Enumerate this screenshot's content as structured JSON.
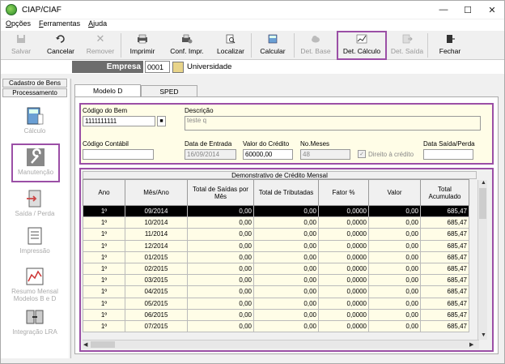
{
  "window": {
    "title": "CIAP/CIAF"
  },
  "menu": [
    "Opções",
    "Ferramentas",
    "Ajuda"
  ],
  "toolbar": [
    {
      "label": "Salvar",
      "icon": "save-icon",
      "disabled": true
    },
    {
      "label": "Cancelar",
      "icon": "undo-icon",
      "disabled": false
    },
    {
      "label": "Remover",
      "icon": "remove-icon",
      "disabled": true
    },
    {
      "label": "Imprimir",
      "icon": "printer-icon",
      "disabled": false
    },
    {
      "label": "Conf. Impr.",
      "icon": "print-settings-icon",
      "disabled": false
    },
    {
      "label": "Localizar",
      "icon": "find-icon",
      "disabled": false
    },
    {
      "label": "Calcular",
      "icon": "calculator-icon",
      "disabled": false
    },
    {
      "label": "Det. Base",
      "icon": "cloud-icon",
      "disabled": true
    },
    {
      "label": "Det. Cálculo",
      "icon": "chart-icon",
      "disabled": false
    },
    {
      "label": "Det. Saída",
      "icon": "exit-detail-icon",
      "disabled": true
    },
    {
      "label": "Fechar",
      "icon": "close-door-icon",
      "disabled": false
    }
  ],
  "empresa": {
    "label": "Empresa",
    "code": "0001",
    "name": "Universidade"
  },
  "sidebar": {
    "tabs": [
      "Cadastro de Bens",
      "Processamento"
    ],
    "items": [
      {
        "label": "Cálculo",
        "icon": "calculator-icon"
      },
      {
        "label": "Manutenção",
        "icon": "wrench-icon"
      },
      {
        "label": "Saída / Perda",
        "icon": "exit-icon"
      },
      {
        "label": "Impressão",
        "icon": "print-icon"
      },
      {
        "label": "Resumo Mensal Modelos B e D",
        "icon": "report-chart-icon"
      },
      {
        "label": "Integração LRA",
        "icon": "integration-icon"
      }
    ]
  },
  "tabs": [
    "Modelo D",
    "SPED"
  ],
  "form": {
    "codigo_bem_label": "Código do Bem",
    "codigo_bem": "1111111111",
    "descricao_label": "Descrição",
    "descricao": "teste q",
    "codigo_contabil_label": "Código Contábil",
    "codigo_contabil": "",
    "data_entrada_label": "Data de Entrada",
    "data_entrada": "16/09/2014",
    "valor_credito_label": "Valor do Crédito",
    "valor_credito": "60000,00",
    "no_meses_label": "No.Meses",
    "no_meses": "48",
    "direito_credito_label": "Direito à crédito",
    "data_saida_label": "Data Saída/Perda",
    "data_saida": ""
  },
  "grid": {
    "title": "Demonstrativo de Crédito Mensal",
    "columns": [
      "Ano",
      "Mês/Ano",
      "Total de Saídas por Mês",
      "Total de Tributadas",
      "Fator %",
      "Valor",
      "Total Acumulado"
    ],
    "rows": [
      [
        "1º",
        "09/2014",
        "0,00",
        "0,00",
        "0,0000",
        "0,00",
        "685,47"
      ],
      [
        "1º",
        "10/2014",
        "0,00",
        "0,00",
        "0,0000",
        "0,00",
        "685,47"
      ],
      [
        "1º",
        "11/2014",
        "0,00",
        "0,00",
        "0,0000",
        "0,00",
        "685,47"
      ],
      [
        "1º",
        "12/2014",
        "0,00",
        "0,00",
        "0,0000",
        "0,00",
        "685,47"
      ],
      [
        "1º",
        "01/2015",
        "0,00",
        "0,00",
        "0,0000",
        "0,00",
        "685,47"
      ],
      [
        "1º",
        "02/2015",
        "0,00",
        "0,00",
        "0,0000",
        "0,00",
        "685,47"
      ],
      [
        "1º",
        "03/2015",
        "0,00",
        "0,00",
        "0,0000",
        "0,00",
        "685,47"
      ],
      [
        "1º",
        "04/2015",
        "0,00",
        "0,00",
        "0,0000",
        "0,00",
        "685,47"
      ],
      [
        "1º",
        "05/2015",
        "0,00",
        "0,00",
        "0,0000",
        "0,00",
        "685,47"
      ],
      [
        "1º",
        "06/2015",
        "0,00",
        "0,00",
        "0,0000",
        "0,00",
        "685,47"
      ],
      [
        "1º",
        "07/2015",
        "0,00",
        "0,00",
        "0,0000",
        "0,00",
        "685,47"
      ]
    ],
    "selected_row": 0
  }
}
